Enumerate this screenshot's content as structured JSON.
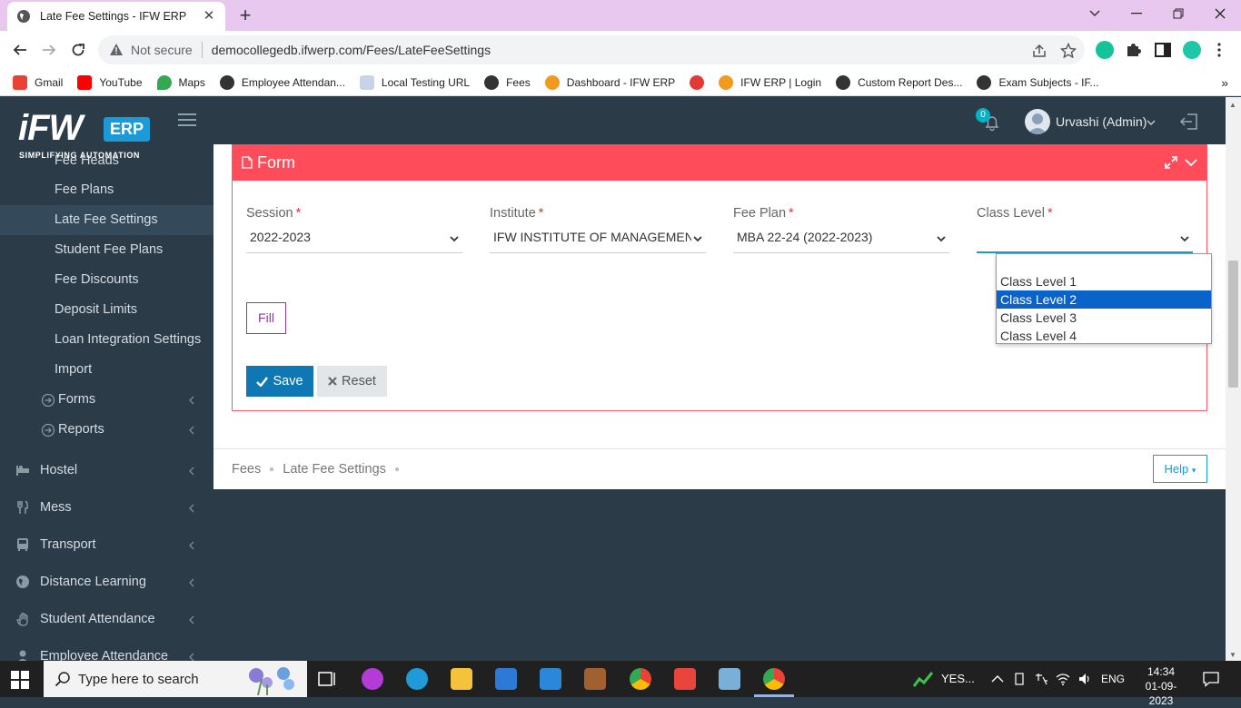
{
  "browser": {
    "tab_title": "Late Fee Settings - IFW ERP",
    "security_label": "Not secure",
    "url": "democollegedb.ifwerp.com/Fees/LateFeeSettings",
    "bookmarks": [
      {
        "label": "Gmail",
        "color": "#ea4335"
      },
      {
        "label": "YouTube",
        "color": "#ff0000"
      },
      {
        "label": "Maps",
        "color": "#34a853"
      },
      {
        "label": "Employee Attendan...",
        "color": "#333333"
      },
      {
        "label": "Local Testing URL",
        "color": "#5b7db1"
      },
      {
        "label": "Fees",
        "color": "#333333"
      },
      {
        "label": "Dashboard - IFW ERP",
        "color": "#f29a1f"
      },
      {
        "label": "",
        "color": "#e53935"
      },
      {
        "label": "IFW ERP | Login",
        "color": "#f29a1f"
      },
      {
        "label": "Custom Report Des...",
        "color": "#333333"
      },
      {
        "label": "Exam Subjects - IF...",
        "color": "#333333"
      }
    ],
    "bookmarks_more": "»"
  },
  "app": {
    "logo_text": "iFW",
    "logo_badge": "ERP",
    "logo_tagline": "SIMPLIFYING AUTOMATION",
    "notification_count": "0",
    "user_name": "Urvashi (Admin)",
    "colors": {
      "header": "#2c3b48",
      "panel_header": "#ff4c5b",
      "save": "#0e77b4",
      "accent": "#1a9ad6"
    }
  },
  "sidebar": {
    "sub_items": [
      "Fee Heads",
      "Fee Plans",
      "Late Fee Settings",
      "Student Fee Plans",
      "Fee Discounts",
      "Deposit Limits",
      "Loan Integration Settings",
      "Import"
    ],
    "active_sub": "Late Fee Settings",
    "sub_groups": [
      "Forms",
      "Reports"
    ],
    "modules": [
      {
        "label": "Hostel",
        "icon": "bed-icon"
      },
      {
        "label": "Mess",
        "icon": "cutlery-icon"
      },
      {
        "label": "Transport",
        "icon": "bus-icon"
      },
      {
        "label": "Distance Learning",
        "icon": "globe-icon"
      },
      {
        "label": "Student Attendance",
        "icon": "hand-icon"
      },
      {
        "label": "Employee Attendance",
        "icon": "user-icon"
      }
    ]
  },
  "form": {
    "title": "Form",
    "fields": [
      {
        "label": "Session",
        "value": "2022-2023",
        "required": "*"
      },
      {
        "label": "Institute",
        "value": "IFW INSTITUTE OF MANAGEMENT",
        "required": "*"
      },
      {
        "label": "Fee Plan",
        "value": "MBA 22-24 (2022-2023)",
        "required": "*"
      },
      {
        "label": "Class Level",
        "value": "",
        "required": "*"
      }
    ],
    "class_level_options": [
      "",
      "Class Level 1",
      "Class Level 2",
      "Class Level 3",
      "Class Level 4"
    ],
    "class_level_highlighted": "Class Level 2",
    "fill_label": "Fill",
    "save_label": "Save",
    "reset_label": "Reset"
  },
  "footer": {
    "breadcrumb": [
      "Fees",
      "Late Fee Settings"
    ],
    "help_label": "Help"
  },
  "taskbar": {
    "search_placeholder": "Type here to search",
    "tray_app_label": "YES...",
    "language": "ENG",
    "time": "14:34",
    "date": "01-09-2023"
  }
}
